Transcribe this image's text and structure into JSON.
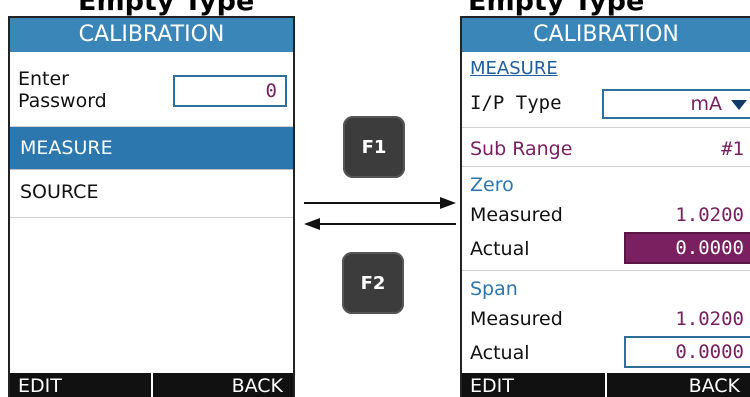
{
  "caption": {
    "left": "Empty Type",
    "right": "Empty Type"
  },
  "left_screen": {
    "title": "CALIBRATION",
    "password_label_line1": "Enter",
    "password_label_line2": "Password",
    "password_value": "0",
    "menu": [
      {
        "label": "MEASURE",
        "selected": true
      },
      {
        "label": "SOURCE",
        "selected": false
      }
    ],
    "softkeys": {
      "left": "EDIT",
      "right": "BACK"
    }
  },
  "keys": {
    "forward": "F1",
    "back": "F2"
  },
  "right_screen": {
    "title": "CALIBRATION",
    "section_link": "MEASURE",
    "ip_type_label": "I/P Type",
    "ip_type_value": "mA",
    "sub_range_label": "Sub Range",
    "sub_range_value": "#1",
    "zero": {
      "heading": "Zero",
      "measured_label": "Measured",
      "measured_value": "1.0200",
      "actual_label": "Actual",
      "actual_value": "0.0000"
    },
    "span": {
      "heading": "Span",
      "measured_label": "Measured",
      "measured_value": "1.0200",
      "actual_label": "Actual",
      "actual_value": "0.0000"
    },
    "softkeys": {
      "left": "EDIT",
      "right": "BACK"
    }
  },
  "colors": {
    "titlebar": "#3b86b9",
    "selected_row": "#2b77ae",
    "value_purple": "#7a2060",
    "softkey_bg": "#111111"
  }
}
